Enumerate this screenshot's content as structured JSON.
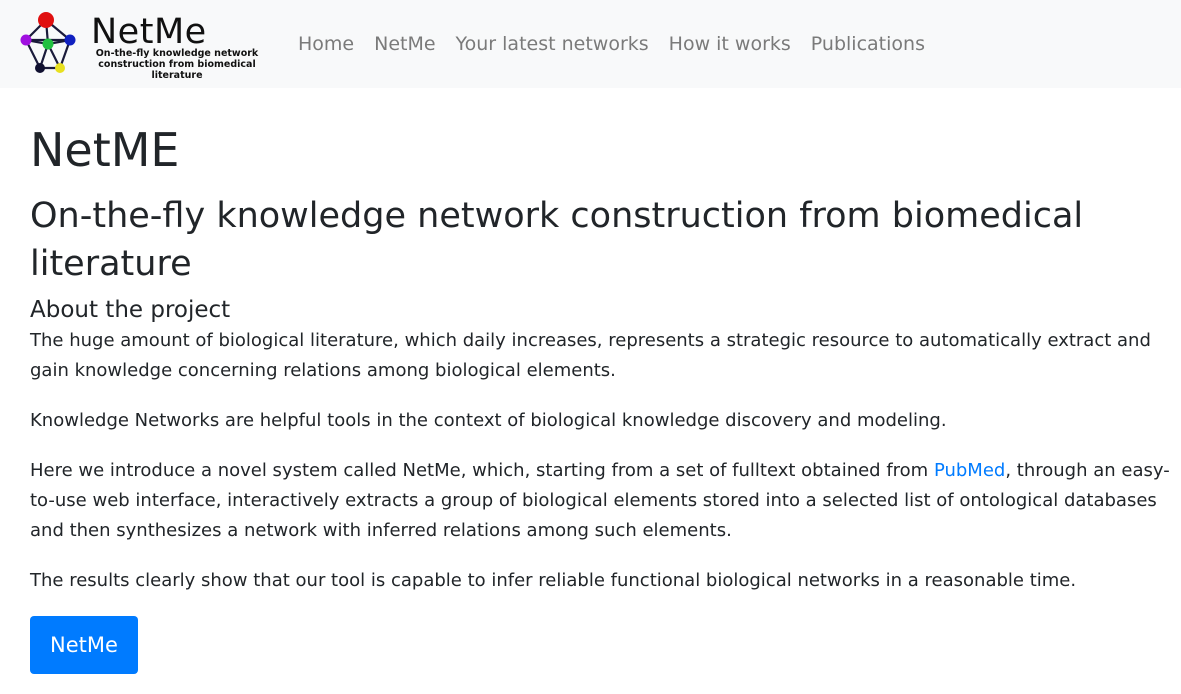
{
  "navbar": {
    "brand": {
      "name": "NetMe",
      "tagline_line1": "On-the-fly knowledge network",
      "tagline_line2": "construction from biomedical literature"
    },
    "links": [
      {
        "label": "Home"
      },
      {
        "label": "NetMe"
      },
      {
        "label": "Your latest networks"
      },
      {
        "label": "How it works"
      },
      {
        "label": "Publications"
      }
    ]
  },
  "main": {
    "title": "NetME",
    "subtitle": "On-the-fly knowledge network construction from biomedical literature",
    "section_heading": "About the project",
    "paragraphs": {
      "p1": "The huge amount of biological literature, which daily increases, represents a strategic resource to automatically extract and gain knowledge concerning relations among biological elements.",
      "p2": "Knowledge Networks are helpful tools in the context of biological knowledge discovery and modeling.",
      "p3_before": "Here we introduce a novel system called NetMe, which, starting from a set of fulltext obtained from ",
      "p3_link": "PubMed",
      "p3_after": ", through an easy-to-use web interface, interactively extracts a group of biological elements stored into a selected list of ontological databases and then synthesizes a network with inferred relations among such elements.",
      "p4": "The results clearly show that our tool is capable to infer reliable functional biological networks in a reasonable time."
    },
    "cta_button": "NetMe"
  },
  "colors": {
    "navbar_bg": "#f8f9fa",
    "nav_link": "#7a7a7a",
    "primary": "#007bff",
    "text": "#212529"
  }
}
